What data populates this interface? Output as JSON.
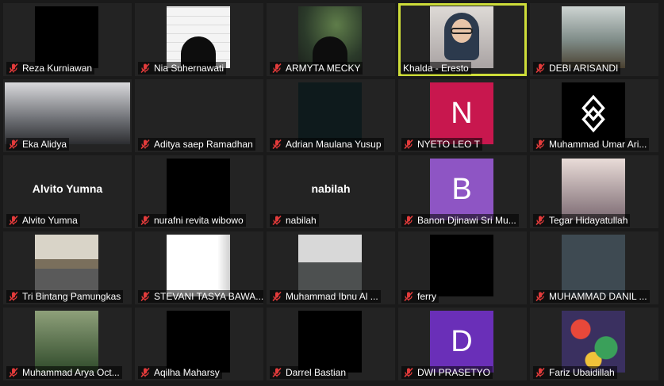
{
  "colors": {
    "background": "#1a1a1a",
    "tile": "#232323",
    "active_border": "#cddc39",
    "mic_muted": "#e33b3b"
  },
  "participants": [
    {
      "name": "Reza Kurniawan",
      "display": "video",
      "video": "black",
      "muted": true
    },
    {
      "name": "Nia Suhernawati",
      "display": "video",
      "video": "brick",
      "muted": true
    },
    {
      "name": "ARMYTA MECKY",
      "display": "video",
      "video": "aurora",
      "muted": true
    },
    {
      "name": "Khalda - Eresto",
      "display": "video",
      "video": "khalda",
      "muted": false,
      "active_speaker": true
    },
    {
      "name": "DEBI ARISANDI",
      "display": "video",
      "video": "sky",
      "muted": true
    },
    {
      "name": "Eka Alidya",
      "display": "video",
      "video": "room",
      "muted": true
    },
    {
      "name": "Aditya saep Ramadhan",
      "display": "video",
      "video": "none",
      "muted": true
    },
    {
      "name": "Adrian Maulana Yusup",
      "display": "video",
      "video": "darkteal",
      "muted": true
    },
    {
      "name": "NYETO LEO T",
      "display": "letter",
      "letter": "N",
      "avatar_color": "#c8174e",
      "muted": true
    },
    {
      "name": "Muhammad Umar Ari...",
      "display": "logo",
      "muted": true
    },
    {
      "name": "Alvito Yumna",
      "display": "name",
      "big_name": "Alvito Yumna",
      "muted": true
    },
    {
      "name": "nurafni revita wibowo",
      "display": "video",
      "video": "black",
      "muted": true
    },
    {
      "name": "nabilah",
      "display": "name",
      "big_name": "nabilah",
      "muted": true
    },
    {
      "name": "Banon Djinawi Sri Mu...",
      "display": "letter",
      "letter": "B",
      "avatar_color": "#8e55c4",
      "muted": true
    },
    {
      "name": "Tegar Hidayatullah",
      "display": "video",
      "video": "anime",
      "muted": true
    },
    {
      "name": "Tri Bintang Pamungkas",
      "display": "video",
      "video": "road",
      "muted": true
    },
    {
      "name": "STEVANI TASYA BAWA...",
      "display": "video",
      "video": "white",
      "muted": true
    },
    {
      "name": "Muhammad Ibnu Al ...",
      "display": "video",
      "video": "pilot",
      "muted": true
    },
    {
      "name": "ferry",
      "display": "video",
      "video": "black",
      "muted": true
    },
    {
      "name": "MUHAMMAD DANIL ...",
      "display": "video",
      "video": "slate",
      "muted": true
    },
    {
      "name": "Muhammad Arya Oct...",
      "display": "video",
      "video": "grass",
      "muted": true
    },
    {
      "name": "Aqilha Maharsy",
      "display": "video",
      "video": "black",
      "muted": true
    },
    {
      "name": "Darrel Bastian",
      "display": "video",
      "video": "black",
      "muted": true
    },
    {
      "name": "DWI PRASETYO",
      "display": "letter",
      "letter": "D",
      "avatar_color": "#6a2fb8",
      "muted": true
    },
    {
      "name": "Fariz Ubaidillah",
      "display": "video",
      "video": "graffiti",
      "muted": true
    }
  ]
}
